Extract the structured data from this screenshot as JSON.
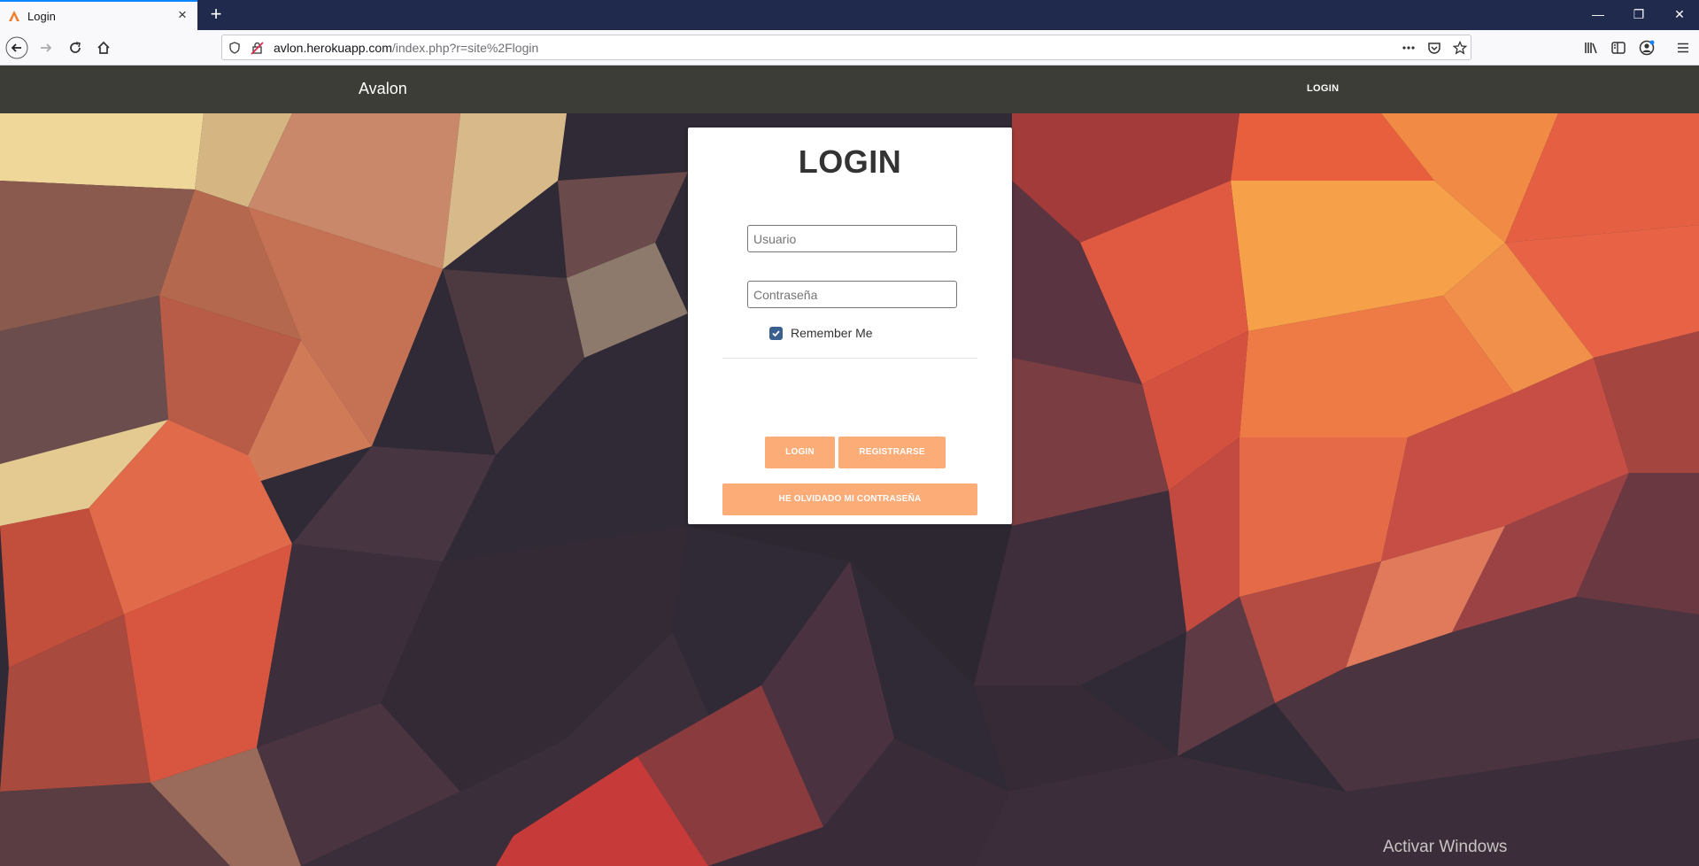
{
  "browser": {
    "tab_title": "Login",
    "new_tab": "+",
    "url_domain": "avlon.herokuapp.com",
    "url_path": "/index.php?r=site%2Flogin",
    "window_controls": [
      "—",
      "❐",
      "✕"
    ]
  },
  "site": {
    "brand": "Avalon",
    "nav_login": "LOGIN"
  },
  "login": {
    "title": "LOGIN",
    "username_placeholder": "Usuario",
    "password_placeholder": "Contraseña",
    "remember_label": "Remember Me",
    "remember_checked": true,
    "login_button": "LOGIN",
    "register_button": "REGISTRARSE",
    "forgot_button": "HE OLVIDADO MI CONTRASEÑA"
  },
  "os": {
    "watermark": "Activar Windows"
  },
  "colors": {
    "header": "#3d3d37",
    "accent_button": "#fcac77",
    "tabstrip": "#1f2a4d"
  }
}
